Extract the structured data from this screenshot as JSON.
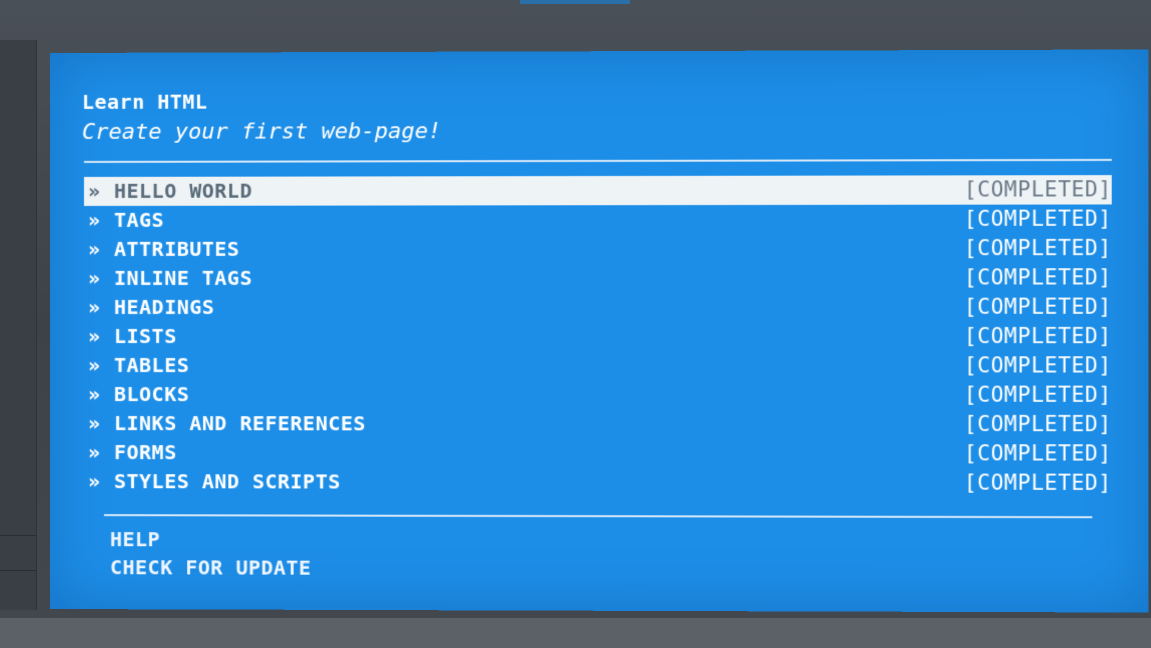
{
  "app": {
    "title": "Learn HTML",
    "subtitle": "Create your first web-page!"
  },
  "menu": {
    "bullet": "»",
    "items": [
      {
        "label": "HELLO WORLD",
        "status": "[COMPLETED]",
        "selected": true
      },
      {
        "label": "TAGS",
        "status": "[COMPLETED]"
      },
      {
        "label": "ATTRIBUTES",
        "status": "[COMPLETED]"
      },
      {
        "label": "INLINE TAGS",
        "status": "[COMPLETED]"
      },
      {
        "label": "HEADINGS",
        "status": "[COMPLETED]"
      },
      {
        "label": "LISTS",
        "status": "[COMPLETED]"
      },
      {
        "label": "TABLES",
        "status": "[COMPLETED]"
      },
      {
        "label": "BLOCKS",
        "status": "[COMPLETED]"
      },
      {
        "label": "LINKS AND REFERENCES",
        "status": "[COMPLETED]"
      },
      {
        "label": "FORMS",
        "status": "[COMPLETED]"
      },
      {
        "label": "STYLES AND SCRIPTS",
        "status": "[COMPLETED]"
      }
    ]
  },
  "footer": {
    "help_label": "HELP",
    "update_label": "CHECK FOR UPDATE"
  },
  "colors": {
    "screen_background": "#1d8ee8",
    "selection_background": "#eef3f6",
    "text": "#ffffff"
  }
}
